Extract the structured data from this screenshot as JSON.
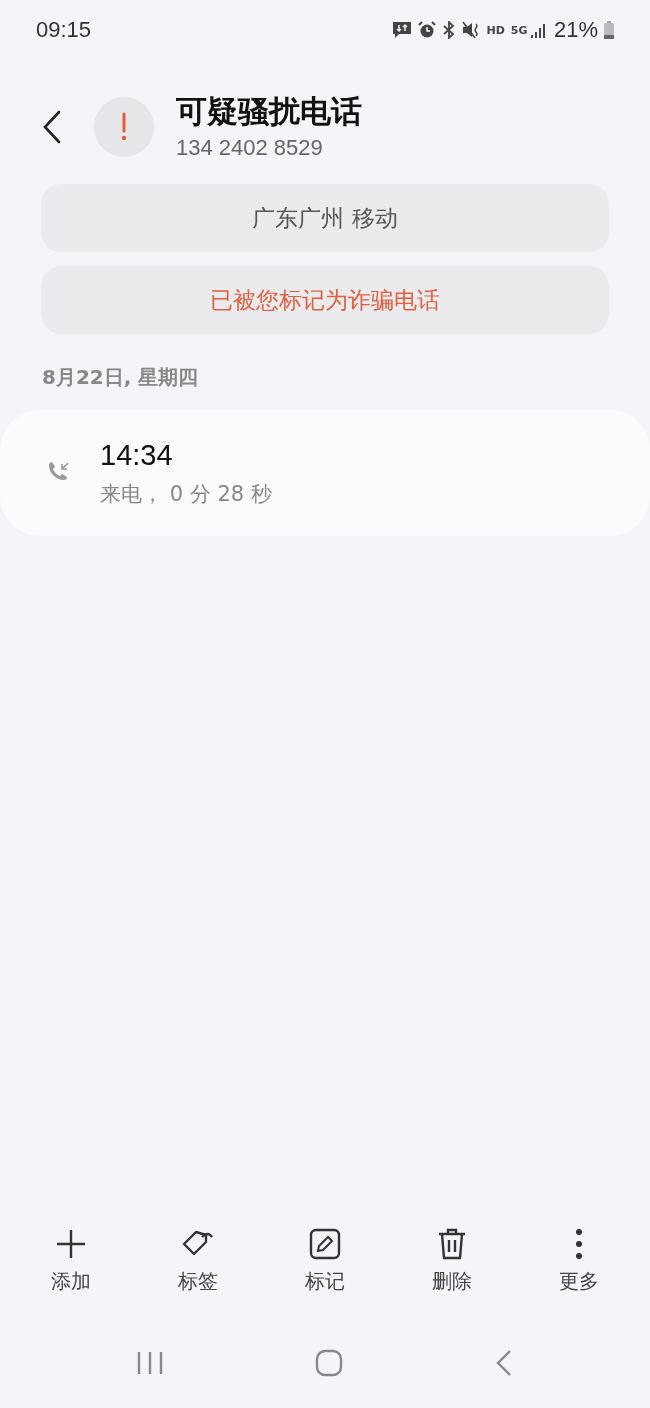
{
  "status_bar": {
    "time": "09:15",
    "hd": "HD",
    "network": "5G",
    "battery": "21%"
  },
  "header": {
    "title": "可疑骚扰电话",
    "number": "134 2402 8529"
  },
  "info_buttons": [
    {
      "label": "广东广州 移动",
      "kind": "info"
    },
    {
      "label": "已被您标记为诈骗电话",
      "kind": "warning"
    }
  ],
  "date": "8月22日, 星期四",
  "calls": [
    {
      "time": "14:34",
      "detail": "来电， 0 分 28 秒",
      "kind": "incoming"
    }
  ],
  "actions": [
    {
      "label": "添加",
      "kind": "add"
    },
    {
      "label": "标签",
      "kind": "tag"
    },
    {
      "label": "标记",
      "kind": "edit"
    },
    {
      "label": "删除",
      "kind": "delete"
    },
    {
      "label": "更多",
      "kind": "more"
    }
  ]
}
